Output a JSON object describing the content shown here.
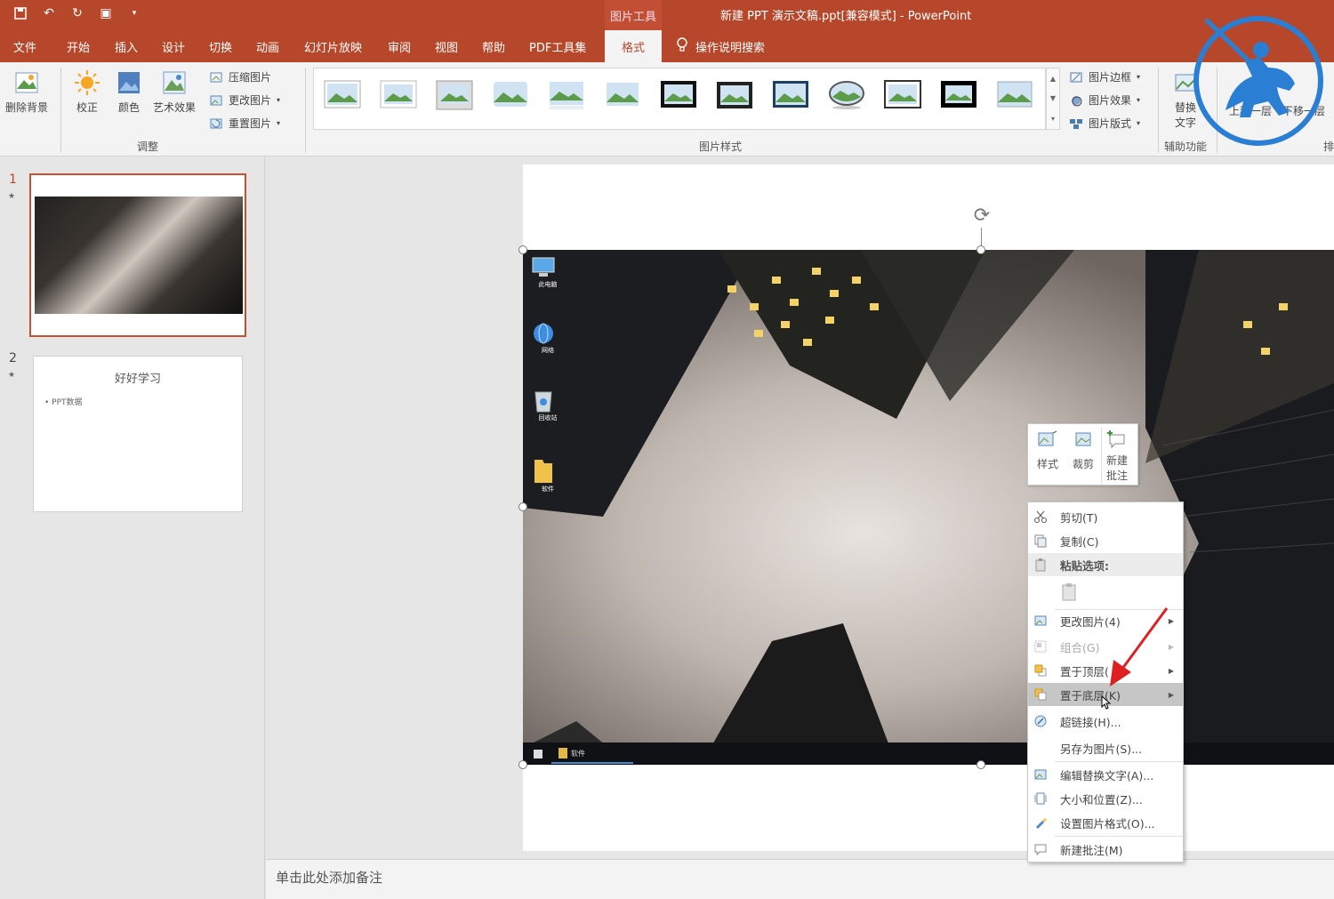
{
  "window": {
    "title": "新建 PPT 演示文稿.ppt[兼容模式] - PowerPoint",
    "contextual_group": "图片工具"
  },
  "tabs": [
    "文件",
    "开始",
    "插入",
    "设计",
    "切换",
    "动画",
    "幻灯片放映",
    "审阅",
    "视图",
    "帮助",
    "PDF工具集",
    "格式"
  ],
  "active_tab": "格式",
  "tell_me": "操作说明搜索",
  "ribbon": {
    "adjust": {
      "remove_bg": "删除背景",
      "corrections": "校正",
      "color": "颜色",
      "artistic": "艺术效果",
      "compress": "压缩图片",
      "change": "更改图片",
      "reset": "重置图片",
      "group_label": "调整"
    },
    "styles": {
      "group_label": "图片样式",
      "border": "图片边框",
      "effects": "图片效果",
      "layout": "图片版式"
    },
    "accessibility": {
      "alt_text_line1": "替换",
      "alt_text_line2": "文字",
      "group_label": "辅助功能"
    },
    "arrange": {
      "bring_forward": "上移一层",
      "send_backward": "下移一层",
      "group_label_fragment": "排"
    }
  },
  "slides": [
    {
      "number": "1",
      "selected": true
    },
    {
      "number": "2",
      "title": "好好学习",
      "bullet": "PPT数据"
    }
  ],
  "desktop_icons": [
    "此电脑",
    "网络",
    "回收站",
    "软件"
  ],
  "taskbar_item": "软件",
  "mini_toolbar": {
    "style": "样式",
    "crop": "裁剪",
    "new_comment_line1": "新建",
    "new_comment_line2": "批注"
  },
  "context_menu": {
    "cut": "剪切(T)",
    "copy": "复制(C)",
    "paste_options": "粘贴选项:",
    "change_picture": "更改图片(4)",
    "group": "组合(G)",
    "bring_to_front": "置于顶层(",
    "send_to_back": "置于底层(K)",
    "hyperlink": "超链接(H)...",
    "save_as_picture": "另存为图片(S)...",
    "edit_alt_text": "编辑替换文字(A)...",
    "size_position": "大小和位置(Z)...",
    "format_picture": "设置图片格式(O)...",
    "new_comment": "新建批注(M)"
  },
  "notes_placeholder": "单击此处添加备注",
  "colors": {
    "accent": "#b7472a",
    "ribbon_bg": "#f3f3f3",
    "highlight": "#c6c6c6",
    "arrow": "#e02020",
    "logo": "#2a7fd4"
  }
}
